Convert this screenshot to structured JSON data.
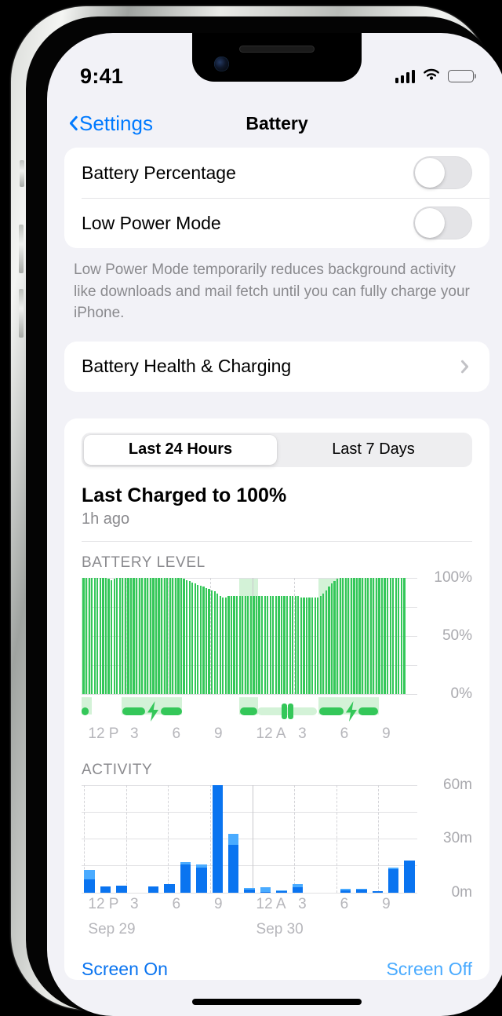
{
  "status_bar": {
    "time": "9:41",
    "cellular_icon": "cellular-bars-icon",
    "wifi_icon": "wifi-icon",
    "battery_icon": "battery-full-icon"
  },
  "nav": {
    "back_label": "Settings",
    "back_icon": "chevron-left-icon",
    "title": "Battery"
  },
  "settings": {
    "rows": [
      {
        "label": "Battery Percentage",
        "toggle": "off"
      },
      {
        "label": "Low Power Mode",
        "toggle": "off"
      }
    ],
    "footnote": "Low Power Mode temporarily reduces background activity like downloads and mail fetch until you can fully charge your iPhone.",
    "health_row": {
      "label": "Battery Health & Charging",
      "icon": "chevron-right-icon"
    }
  },
  "usage": {
    "segments": [
      {
        "label": "Last 24 Hours",
        "selected": true
      },
      {
        "label": "Last 7 Days",
        "selected": false
      }
    ],
    "last_charged_title": "Last Charged to 100%",
    "last_charged_sub": "1h ago",
    "battery_level_heading": "BATTERY LEVEL",
    "activity_heading": "ACTIVITY",
    "legend": {
      "screen_on": "Screen On",
      "screen_off": "Screen Off",
      "screen_on_color": "#0a74f0",
      "screen_off_color": "#4aabff"
    }
  },
  "colors": {
    "accent_blue": "#007aff",
    "battery_green": "#34c759",
    "battery_green_band": "#d3f2d7",
    "screen_on_blue": "#0a74f0",
    "screen_off_blue": "#4aabff",
    "page_background": "#f2f2f7",
    "card_background": "#ffffff"
  },
  "chart_data": [
    {
      "type": "bar",
      "name": "battery-level-chart",
      "title": "BATTERY LEVEL",
      "ylabel": "",
      "ylim": [
        0,
        100
      ],
      "yticks": [
        0,
        25,
        50,
        75,
        100
      ],
      "ytick_labels": [
        "0%",
        "",
        "50%",
        "",
        "100%"
      ],
      "xlabel": "",
      "xticks": [
        "12 P",
        "3",
        "6",
        "9",
        "12 A",
        "3",
        "6",
        "9"
      ],
      "xtick_positions_pct": [
        0.8,
        13.3,
        25.8,
        38.3,
        50.8,
        63.3,
        75.8,
        88.3
      ],
      "bar_color": "#34c759",
      "charging_band_color": "#d3f2d7",
      "grid": true,
      "values": [
        100,
        100,
        100,
        100,
        100,
        100,
        100,
        100,
        100,
        99,
        98,
        99,
        100,
        100,
        100,
        100,
        100,
        100,
        100,
        100,
        100,
        100,
        100,
        100,
        100,
        100,
        100,
        100,
        100,
        100,
        100,
        100,
        100,
        100,
        100,
        100,
        99,
        98,
        97,
        96,
        95,
        94,
        93,
        92,
        91,
        90,
        89,
        88,
        86,
        84,
        83,
        83,
        84,
        84,
        84,
        84,
        84,
        84,
        84,
        84,
        84,
        84,
        84,
        84,
        84,
        84,
        84,
        84,
        84,
        84,
        84,
        84,
        84,
        84,
        84,
        84,
        84,
        84,
        83,
        83,
        83,
        83,
        83,
        83,
        83,
        84,
        86,
        89,
        92,
        95,
        97,
        99,
        100,
        100,
        100,
        100,
        100,
        100,
        100,
        100,
        100,
        100,
        100,
        100,
        100,
        100,
        100,
        100,
        100,
        100,
        100,
        100,
        100,
        100,
        100,
        100
      ],
      "charging_bands": [
        {
          "start_pct": 0.0,
          "end_pct": 3.0
        },
        {
          "start_pct": 12.0,
          "end_pct": 30.0
        },
        {
          "start_pct": 47.0,
          "end_pct": 52.5
        },
        {
          "start_pct": 70.5,
          "end_pct": 88.5
        }
      ],
      "charging_segments": [
        {
          "start_pct": 0.0,
          "end_pct": 2.2,
          "icon": null,
          "style": "solid"
        },
        {
          "start_pct": 12.2,
          "end_pct": 19.0,
          "icon": null,
          "style": "solid"
        },
        {
          "start_pct": 19.0,
          "end_pct": 23.5,
          "icon": "bolt-icon",
          "style": "icon"
        },
        {
          "start_pct": 23.5,
          "end_pct": 29.8,
          "icon": null,
          "style": "solid"
        },
        {
          "start_pct": 47.2,
          "end_pct": 52.2,
          "icon": null,
          "style": "solid"
        },
        {
          "start_pct": 52.2,
          "end_pct": 70.0,
          "icon": null,
          "style": "dim"
        },
        {
          "start_pct": 59.5,
          "end_pct": 61.5,
          "icon": "pause-icon",
          "style": "pause"
        },
        {
          "start_pct": 70.7,
          "end_pct": 78.0,
          "icon": null,
          "style": "solid"
        },
        {
          "start_pct": 78.0,
          "end_pct": 82.5,
          "icon": "bolt-icon",
          "style": "icon"
        },
        {
          "start_pct": 82.5,
          "end_pct": 88.3,
          "icon": null,
          "style": "solid"
        }
      ]
    },
    {
      "type": "bar",
      "name": "activity-chart",
      "title": "ACTIVITY",
      "ylabel": "",
      "ylim": [
        0,
        60
      ],
      "yticks": [
        0,
        15,
        30,
        45,
        60
      ],
      "ytick_labels": [
        "0m",
        "",
        "30m",
        "",
        "60m"
      ],
      "xlabel": "",
      "xticks": [
        "12 P",
        "3",
        "6",
        "9",
        "12 A",
        "3",
        "6",
        "9"
      ],
      "xtick_positions_pct": [
        0.8,
        13.3,
        25.8,
        38.3,
        50.8,
        63.3,
        75.8,
        88.3
      ],
      "date_labels": [
        {
          "text": "Sep 29",
          "position_pct": 0.8
        },
        {
          "text": "Sep 30",
          "position_pct": 50.8
        }
      ],
      "stacked": true,
      "series": [
        {
          "name": "Screen On",
          "color": "#0a74f0",
          "values": [
            7.5,
            3.5,
            4.0,
            0,
            3.5,
            4.5,
            15.5,
            14.0,
            60.0,
            26.5,
            1.5,
            0.5,
            1.0,
            3.0,
            0,
            0,
            1.0,
            1.5,
            0.8,
            13.0,
            18.0
          ]
        },
        {
          "name": "Screen Off",
          "color": "#4aabff",
          "values": [
            5.0,
            0,
            0,
            0,
            0,
            0,
            1.5,
            1.5,
            0,
            6.0,
            0.8,
            2.5,
            0.3,
            1.5,
            0,
            0,
            1.0,
            0.5,
            0,
            1.0,
            0
          ]
        }
      ],
      "bar_slot_count": 21,
      "grid": true
    }
  ]
}
